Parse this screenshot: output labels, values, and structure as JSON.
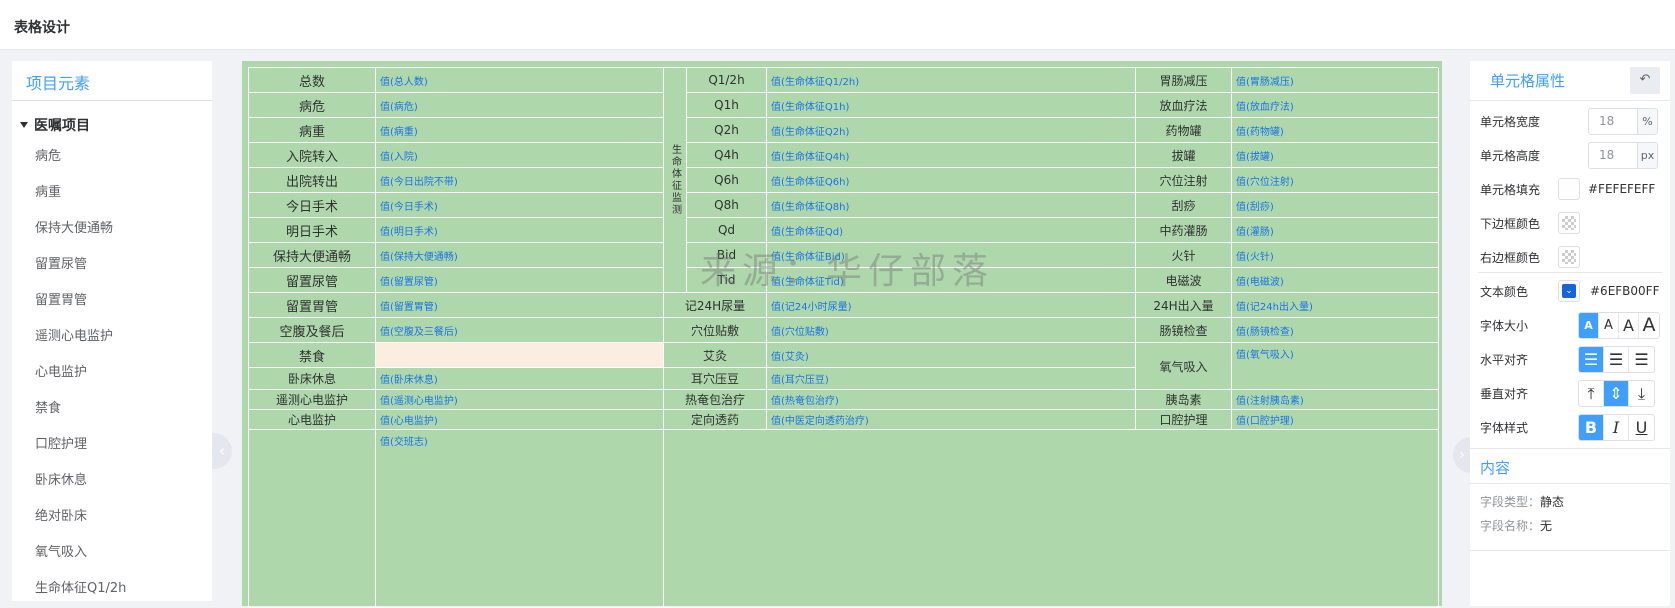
{
  "header": {
    "title": "表格设计"
  },
  "left": {
    "title": "项目元素",
    "group": "医嘱项目",
    "items": [
      "病危",
      "病重",
      "保持大便通畅",
      "留置尿管",
      "留置胃管",
      "遥测心电监护",
      "心电监护",
      "禁食",
      "口腔护理",
      "卧床休息",
      "绝对卧床",
      "氧气吸入",
      "生命体征Q1/2h"
    ]
  },
  "table": {
    "col1": [
      {
        "label": "总数",
        "value": "值(总人数)"
      },
      {
        "label": "病危",
        "value": "值(病危)"
      },
      {
        "label": "病重",
        "value": "值(病重)"
      },
      {
        "label": "入院转入",
        "value": "值(入院)"
      },
      {
        "label": "出院转出",
        "value": "值(今日出院不带)"
      },
      {
        "label": "今日手术",
        "value": "值(今日手术)"
      },
      {
        "label": "明日手术",
        "value": "值(明日手术)"
      },
      {
        "label": "保持大便通畅",
        "value": "值(保持大便通畅)"
      },
      {
        "label": "留置尿管",
        "value": "值(留置尿管)"
      },
      {
        "label": "留置胃管",
        "value": "值(留置胃管)"
      },
      {
        "label": "空腹及餐后",
        "value": "值(空腹及三餐后)"
      },
      {
        "label": "禁食",
        "value": ""
      },
      {
        "label": "卧床休息",
        "value": "值(卧床休息)"
      },
      {
        "label": "遥测心电监护",
        "value": "值(遥测心电监护)"
      },
      {
        "label": "心电监护",
        "value": "值(心电监护)"
      },
      {
        "label": "",
        "value": "值(交班志)"
      }
    ],
    "vital_group": "生命体征监测",
    "col2": [
      {
        "label": "Q1/2h",
        "value": "值(生命体征Q1/2h)"
      },
      {
        "label": "Q1h",
        "value": "值(生命体征Q1h)"
      },
      {
        "label": "Q2h",
        "value": "值(生命体征Q2h)"
      },
      {
        "label": "Q4h",
        "value": "值(生命体征Q4h)"
      },
      {
        "label": "Q6h",
        "value": "值(生命体征Q6h)"
      },
      {
        "label": "Q8h",
        "value": "值(生命体征Q8h)"
      },
      {
        "label": "Qd",
        "value": "值(生命体征Qd)"
      },
      {
        "label": "Bid",
        "value": "值(生命体征Bid)"
      },
      {
        "label": "Tid",
        "value": "值(生命体征Tid)"
      },
      {
        "label": "记24H尿量",
        "value": "值(记24小时尿量)"
      },
      {
        "label": "穴位贴敷",
        "value": "值(穴位贴敷)"
      },
      {
        "label": "艾灸",
        "value": "值(艾灸)"
      },
      {
        "label": "耳穴压豆",
        "value": "值(耳穴压豆)"
      },
      {
        "label": "热奄包治疗",
        "value": "值(热奄包治疗)"
      },
      {
        "label": "定向透药",
        "value": "值(中医定向透药治疗)"
      }
    ],
    "col3": [
      {
        "label": "胃肠减压",
        "value": "值(胃肠减压)"
      },
      {
        "label": "放血疗法",
        "value": "值(放血疗法)"
      },
      {
        "label": "药物罐",
        "value": "值(药物罐)"
      },
      {
        "label": "拔罐",
        "value": "值(拔罐)"
      },
      {
        "label": "穴位注射",
        "value": "值(穴位注射)"
      },
      {
        "label": "刮痧",
        "value": "值(刮痧)"
      },
      {
        "label": "中药灌肠",
        "value": "值(灌肠)"
      },
      {
        "label": "火针",
        "value": "值(火针)"
      },
      {
        "label": "电磁波",
        "value": "值(电磁波)"
      },
      {
        "label": "24H出入量",
        "value": "值(记24h出入量)"
      },
      {
        "label": "肠镜检查",
        "value": "值(肠镜检查)"
      },
      {
        "label": "氧气吸入",
        "value": "值(氧气吸入)"
      },
      {
        "label": "胰岛素",
        "value": "值(注射胰岛素)"
      },
      {
        "label": "口腔护理",
        "value": "值(口腔护理)"
      }
    ]
  },
  "watermark": "来源：华仔部落",
  "props": {
    "title": "单元格属性",
    "undo_icon": "↶",
    "width_label": "单元格宽度",
    "width_value": "18",
    "width_unit": "%",
    "height_label": "单元格高度",
    "height_value": "18",
    "height_unit": "px",
    "fill_label": "单元格填充",
    "fill_hex": "#FEFEFEFF",
    "bottom_border_label": "下边框颜色",
    "right_border_label": "右边框颜色",
    "text_color_label": "文本颜色",
    "text_color_hex": "#6EFB00FF",
    "font_size_label": "字体大小",
    "halign_label": "水平对齐",
    "valign_label": "垂直对齐",
    "font_style_label": "字体样式",
    "content_title": "内容",
    "field_type_label": "字段类型：",
    "field_type_value": "静态",
    "field_name_label": "字段名称：",
    "field_name_value": "无"
  },
  "colors": {
    "accent": "#409eff",
    "table_bg": "#aed8ab",
    "value_text": "#1a73e8",
    "highlight_cell": "#fbeee0"
  }
}
